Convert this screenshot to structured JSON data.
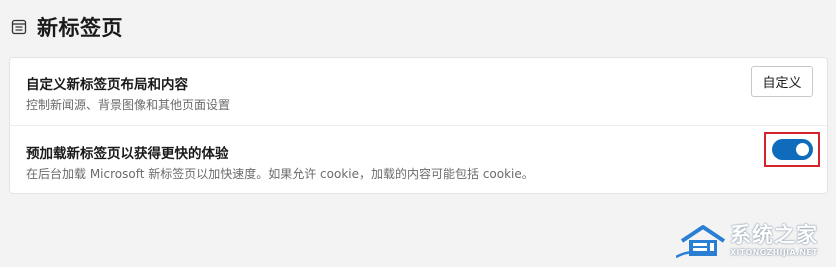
{
  "header": {
    "title": "新标签页",
    "icon": "new-tab-page-icon"
  },
  "settings": {
    "customize": {
      "title": "自定义新标签页布局和内容",
      "description": "控制新闻源、背景图像和其他页面设置",
      "button_label": "自定义"
    },
    "preload": {
      "title": "预加载新标签页以获得更快的体验",
      "description": "在后台加载 Microsoft 新标签页以加快速度。如果允许 cookie，加载的内容可能包括 cookie。",
      "toggle_on": true
    }
  },
  "watermark": {
    "main": "系统之家",
    "sub": "XITONGZHIJIA.NET"
  },
  "colors": {
    "accent": "#0f6cbd",
    "highlight": "#d6222a",
    "background": "#f3f3f3"
  }
}
